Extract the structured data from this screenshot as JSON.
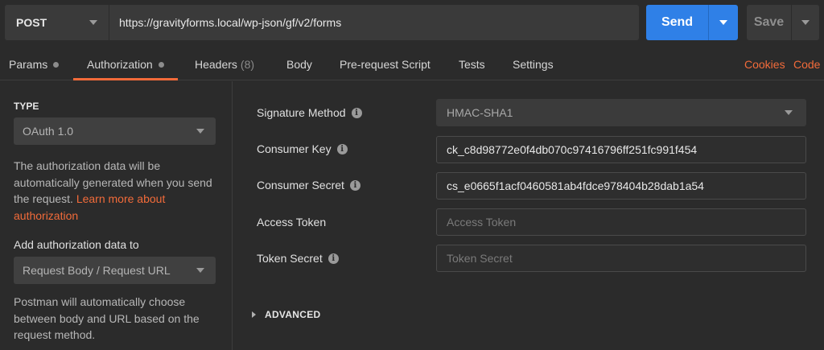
{
  "request": {
    "method": "POST",
    "url": "https://gravityforms.local/wp-json/gf/v2/forms",
    "send_label": "Send",
    "save_label": "Save"
  },
  "tabs": [
    {
      "label": "Params"
    },
    {
      "label": "Authorization"
    },
    {
      "label": "Headers",
      "count": "(8)"
    },
    {
      "label": "Body"
    },
    {
      "label": "Pre-request Script"
    },
    {
      "label": "Tests"
    },
    {
      "label": "Settings"
    }
  ],
  "right_links": {
    "cookies": "Cookies",
    "code": "Code"
  },
  "auth": {
    "type_heading": "TYPE",
    "type_value": "OAuth 1.0",
    "desc_plain": "The authorization data will be automatically generated when you send the request.",
    "learn_more": "Learn more about authorization",
    "add_heading": "Add authorization data to",
    "add_value": "Request Body / Request URL",
    "add_desc": "Postman will automatically choose between body and URL based on the request method."
  },
  "form": {
    "signature_method": {
      "label": "Signature Method",
      "value": "HMAC-SHA1"
    },
    "consumer_key": {
      "label": "Consumer Key",
      "value": "ck_c8d98772e0f4db070c97416796ff251fc991f454"
    },
    "consumer_secret": {
      "label": "Consumer Secret",
      "value": "cs_e0665f1acf0460581ab4fdce978404b28dab1a54"
    },
    "access_token": {
      "label": "Access Token",
      "placeholder": "Access Token"
    },
    "token_secret": {
      "label": "Token Secret",
      "placeholder": "Token Secret"
    },
    "advanced_label": "ADVANCED"
  },
  "colors": {
    "accent": "#f26b3a",
    "send": "#2f80e7",
    "background": "#2b2b2b"
  }
}
